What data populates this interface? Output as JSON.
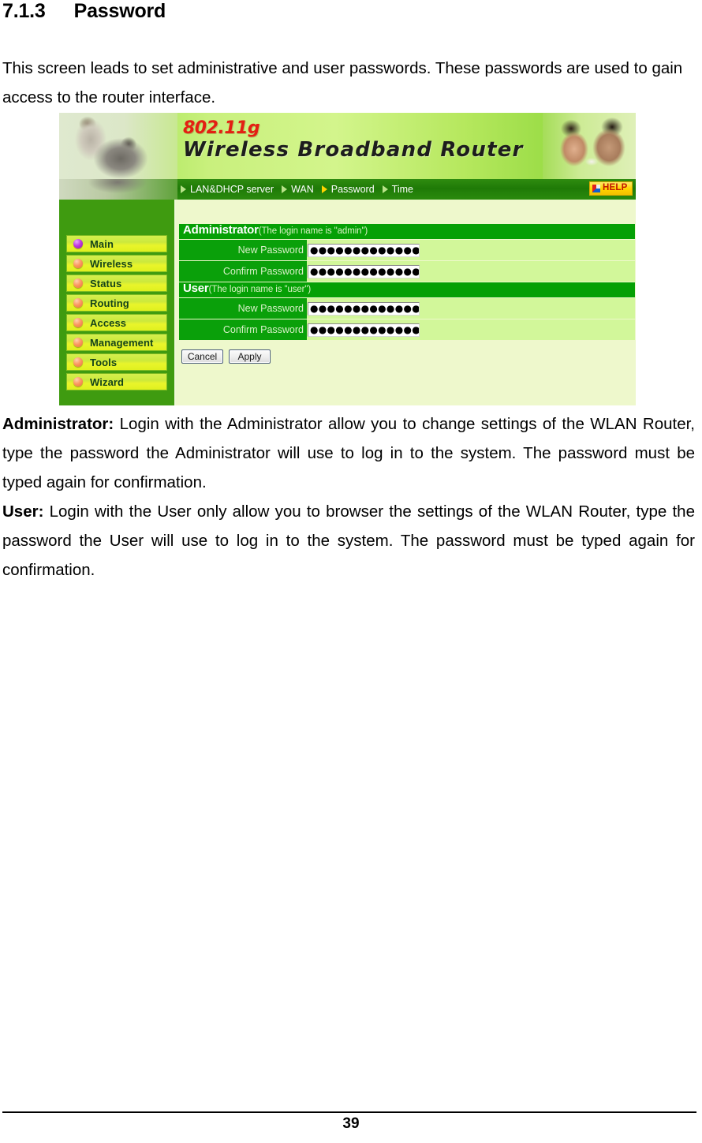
{
  "document": {
    "heading_number": "7.1.3",
    "heading_title": "Password",
    "intro": "This screen leads to set administrative and user passwords. These passwords are used to gain access to the router interface.",
    "admin_para_bold": "Administrator:",
    "admin_para_text": " Login with the Administrator allow you to change settings of the WLAN Router, type the password the Administrator will use to log in to the system. The password must be typed again for confirmation.",
    "user_para_bold": "User:",
    "user_para_text": " Login with the User only allow you to browser the settings of the WLAN Router, type the password the User will use to log in to the system. The password must be typed again for confirmation.",
    "page_number": "39"
  },
  "screenshot": {
    "banner": {
      "logo_standard": "802.11g",
      "logo_product": "Wireless Broadband Router"
    },
    "navbar": {
      "items": [
        {
          "label": "LAN&DHCP server",
          "active": false
        },
        {
          "label": "WAN",
          "active": false
        },
        {
          "label": "Password",
          "active": true
        },
        {
          "label": "Time",
          "active": false
        }
      ],
      "help_label": "HELP"
    },
    "sidebar": {
      "items": [
        {
          "label": "Main",
          "bullet": "purple"
        },
        {
          "label": "Wireless",
          "bullet": "orange"
        },
        {
          "label": "Status",
          "bullet": "orange"
        },
        {
          "label": "Routing",
          "bullet": "orange"
        },
        {
          "label": "Access",
          "bullet": "orange"
        },
        {
          "label": "Management",
          "bullet": "orange"
        },
        {
          "label": "Tools",
          "bullet": "orange"
        },
        {
          "label": "Wizard",
          "bullet": "orange"
        }
      ]
    },
    "form": {
      "admin_section_title": "Administrator",
      "admin_section_note": "(The login name is \"admin\")",
      "admin_new_password_label": "New Password",
      "admin_new_password_value": "●●●●●●●●●●●●●●●●●",
      "admin_confirm_password_label": "Confirm Password",
      "admin_confirm_password_value": "●●●●●●●●●●●●●●●●●",
      "user_section_title": "User",
      "user_section_note": "(The login name is \"user\")",
      "user_new_password_label": "New Password",
      "user_new_password_value": "●●●●●●●●●●●●●●●●●",
      "user_confirm_password_label": "Confirm Password",
      "user_confirm_password_value": "●●●●●●●●●●●●●●●●●",
      "cancel_label": "Cancel",
      "apply_label": "Apply"
    },
    "colors": {
      "nav_green": "#1f7a07",
      "section_green": "#05a005",
      "row_green": "#0aa00a",
      "field_green": "#d2f79a",
      "content_bg": "#eef8cc",
      "sidebar_green": "#3f9b10",
      "logo_red": "#e41f12",
      "help_yellow": "#ffd400",
      "active_arrow": "#ffd400"
    }
  }
}
